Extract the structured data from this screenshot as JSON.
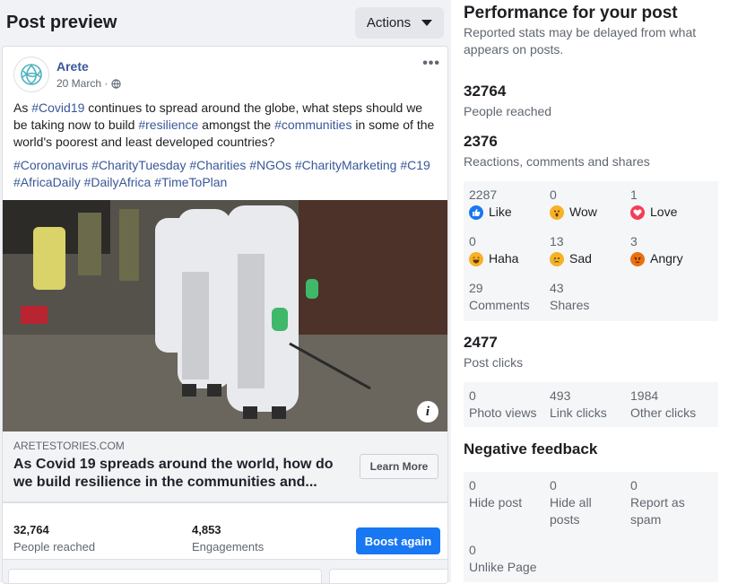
{
  "preview": {
    "title": "Post preview",
    "actions_label": "Actions"
  },
  "post": {
    "page_name": "Arete",
    "date": "20 March ·",
    "more_icon": "more-dots-icon",
    "text_parts": [
      {
        "t": "As ",
        "tag": false
      },
      {
        "t": "#Covid19",
        "tag": true
      },
      {
        "t": " continues to spread around the globe, what steps should we be taking now to build ",
        "tag": false
      },
      {
        "t": "#resilience",
        "tag": true
      },
      {
        "t": " amongst the ",
        "tag": false
      },
      {
        "t": "#communities",
        "tag": true
      },
      {
        "t": " in some of the world's poorest and least developed countries?",
        "tag": false
      }
    ],
    "hashtags": "#Coronavirus #CharityTuesday #Charities #NGOs #CharityMarketing #C19 #AfricaDaily #DailyAfrica #TimeToPlan",
    "link_domain": "ARETESTORIES.COM",
    "link_title": "As Covid 19 spreads around the world, how do we build resilience in the communities and...",
    "learn_more": "Learn More",
    "people_reached_num": "32,764",
    "people_reached_label": "People reached",
    "engagements_num": "4,853",
    "engagements_label": "Engagements",
    "boost_label": "Boost again"
  },
  "performance": {
    "title": "Performance for your post",
    "subtitle": "Reported stats may be delayed from what appears on posts.",
    "people_reached": {
      "value": "32764",
      "label": "People reached"
    },
    "reactions": {
      "value": "2376",
      "label": "Reactions, comments and shares"
    },
    "reaction_items": [
      {
        "value": "2287",
        "label": "Like",
        "icon": "like-icon",
        "color": "#1877f2"
      },
      {
        "value": "0",
        "label": "Wow",
        "icon": "wow-icon",
        "color": "#f7b125"
      },
      {
        "value": "1",
        "label": "Love",
        "icon": "love-icon",
        "color": "#f33e58"
      },
      {
        "value": "0",
        "label": "Haha",
        "icon": "haha-icon",
        "color": "#f7b125"
      },
      {
        "value": "13",
        "label": "Sad",
        "icon": "sad-icon",
        "color": "#f7b125"
      },
      {
        "value": "3",
        "label": "Angry",
        "icon": "angry-icon",
        "color": "#e9710f"
      }
    ],
    "comments": {
      "value": "29",
      "label": "Comments"
    },
    "shares": {
      "value": "43",
      "label": "Shares"
    },
    "post_clicks": {
      "value": "2477",
      "label": "Post clicks"
    },
    "click_items": [
      {
        "value": "0",
        "label": "Photo views"
      },
      {
        "value": "493",
        "label": "Link clicks"
      },
      {
        "value": "1984",
        "label": "Other clicks"
      }
    ],
    "negative_title": "Negative feedback",
    "negative_items": [
      {
        "value": "0",
        "label": "Hide post"
      },
      {
        "value": "0",
        "label": "Hide all posts"
      },
      {
        "value": "0",
        "label": "Report as spam"
      },
      {
        "value": "0",
        "label": "Unlike Page"
      }
    ]
  },
  "colors": {
    "link": "#385898",
    "primary": "#1877f2",
    "muted": "#606770"
  }
}
